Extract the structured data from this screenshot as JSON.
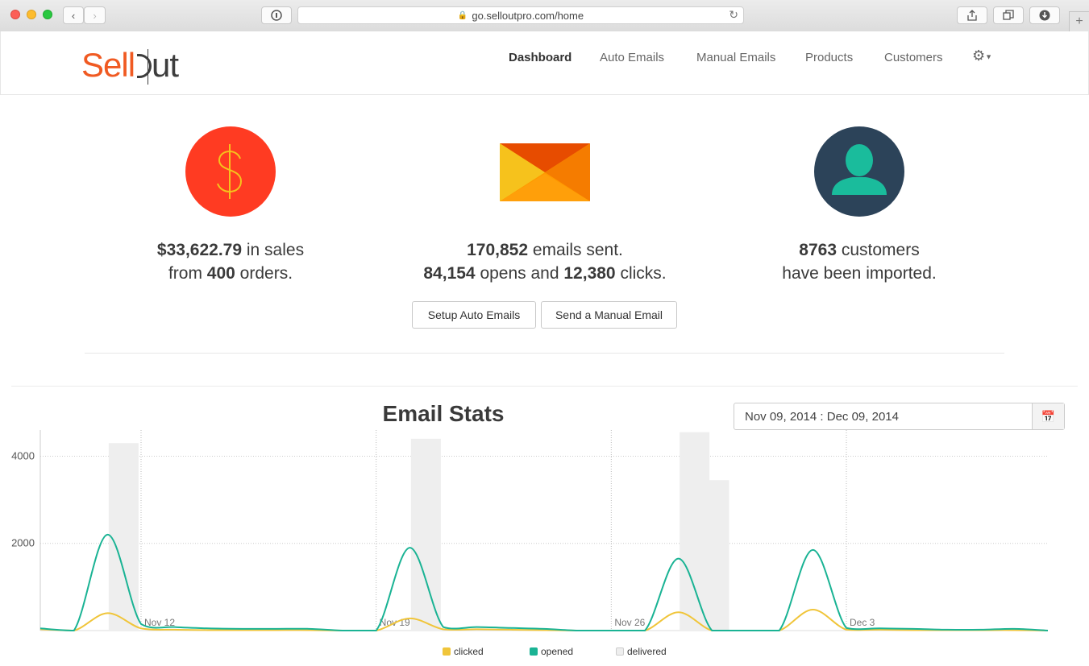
{
  "browser": {
    "url": "go.selloutpro.com/home"
  },
  "brand": {
    "part1": "Sell",
    "part2": "ut"
  },
  "nav": {
    "items": [
      "Dashboard",
      "Auto Emails",
      "Manual Emails",
      "Products",
      "Customers"
    ],
    "active": "Dashboard"
  },
  "sales": {
    "amount": "$33,622.79",
    "line1_suffix": " in sales",
    "line2_prefix": "from ",
    "orders": "400",
    "line2_suffix": " orders."
  },
  "emails": {
    "sent": "170,852",
    "sent_suffix": " emails sent.",
    "opens": "84,154",
    "mid": " opens and ",
    "clicks": "12,380",
    "clicks_suffix": " clicks."
  },
  "customers": {
    "count": "8763",
    "suffix": " customers",
    "line2": "have been imported."
  },
  "buttons": {
    "setup_auto": "Setup Auto Emails",
    "send_manual": "Send a Manual Email"
  },
  "email_stats": {
    "title": "Email Stats",
    "date_range": "Nov 09, 2014 : Dec 09, 2014"
  },
  "colors": {
    "clicked": "#f0c53a",
    "opened": "#1ab394",
    "delivered": "#eeeeee",
    "dollar": "#ff3b22",
    "user": "#2c4359"
  },
  "chart_data": {
    "type": "line",
    "x": [
      "Nov 9",
      "Nov 10",
      "Nov 11",
      "Nov 12",
      "Nov 13",
      "Nov 14",
      "Nov 15",
      "Nov 16",
      "Nov 17",
      "Nov 18",
      "Nov 19",
      "Nov 20",
      "Nov 21",
      "Nov 22",
      "Nov 23",
      "Nov 24",
      "Nov 25",
      "Nov 26",
      "Nov 27",
      "Nov 28",
      "Nov 29",
      "Nov 30",
      "Dec 1",
      "Dec 2",
      "Dec 3",
      "Dec 4",
      "Dec 5",
      "Dec 6",
      "Dec 7",
      "Dec 8",
      "Dec 9"
    ],
    "x_ticks": [
      "Nov 12",
      "Nov 19",
      "Nov 26",
      "Dec 3"
    ],
    "y_ticks": [
      2000,
      4000
    ],
    "ylim": [
      0,
      4600
    ],
    "series": [
      {
        "name": "delivered",
        "kind": "bar",
        "values": [
          0,
          0,
          4300,
          0,
          0,
          0,
          0,
          0,
          0,
          0,
          0,
          4400,
          0,
          0,
          0,
          0,
          0,
          0,
          0,
          4550,
          0,
          0,
          0,
          0,
          0,
          0,
          0,
          0,
          0,
          0,
          0
        ]
      },
      {
        "name": "delivered",
        "kind": "bar-extra",
        "values": []
      },
      {
        "name": "opened",
        "values": [
          50,
          0,
          2200,
          150,
          80,
          50,
          40,
          40,
          40,
          0,
          0,
          1900,
          80,
          80,
          60,
          40,
          0,
          0,
          0,
          1650,
          0,
          0,
          0,
          1850,
          60,
          50,
          40,
          20,
          20,
          40,
          0
        ]
      },
      {
        "name": "clicked",
        "values": [
          30,
          0,
          400,
          50,
          20,
          10,
          10,
          10,
          10,
          0,
          0,
          280,
          30,
          30,
          20,
          10,
          0,
          0,
          0,
          420,
          0,
          0,
          0,
          480,
          20,
          20,
          10,
          10,
          10,
          10,
          0
        ]
      }
    ],
    "extra_bar": {
      "x": "Nov 29",
      "value": 3450
    },
    "legend": [
      "clicked",
      "opened",
      "delivered"
    ],
    "grid": true
  }
}
